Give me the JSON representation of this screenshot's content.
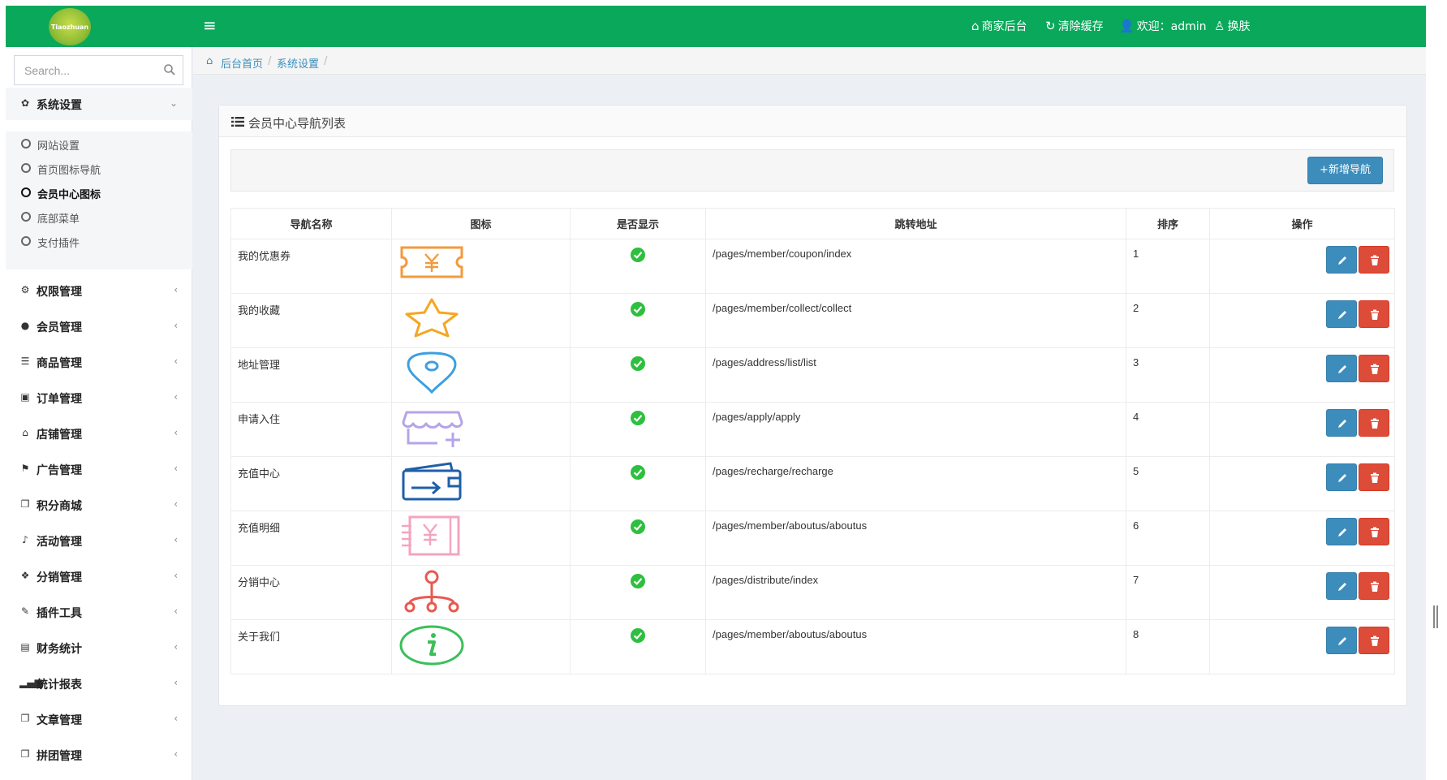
{
  "topbar": {
    "logo_text": "Tiaozhuan",
    "links": [
      {
        "label": "商家后台",
        "icon": "home-icon"
      },
      {
        "label": "清除缓存",
        "icon": "refresh-icon"
      },
      {
        "label": "欢迎：admin",
        "icon": "user-icon"
      },
      {
        "label": "换肤",
        "icon": "person-icon"
      }
    ]
  },
  "sidebar": {
    "search_placeholder": "Search...",
    "active_group": {
      "label": "系统设置",
      "icon": "gear-icon"
    },
    "sub_items": [
      {
        "label": "网站设置"
      },
      {
        "label": "首页图标导航"
      },
      {
        "label": "会员中心图标"
      },
      {
        "label": "底部菜单"
      },
      {
        "label": "支付插件"
      }
    ],
    "groups": [
      {
        "label": "权限管理",
        "icon": "cogs-icon"
      },
      {
        "label": "会员管理",
        "icon": "user-icon"
      },
      {
        "label": "商品管理",
        "icon": "list-icon"
      },
      {
        "label": "订单管理",
        "icon": "money-icon"
      },
      {
        "label": "店铺管理",
        "icon": "home-icon"
      },
      {
        "label": "广告管理",
        "icon": "flag-icon"
      },
      {
        "label": "积分商城",
        "icon": "copy-icon"
      },
      {
        "label": "活动管理",
        "icon": "bell-icon"
      },
      {
        "label": "分销管理",
        "icon": "cubes-icon"
      },
      {
        "label": "插件工具",
        "icon": "plug-icon"
      },
      {
        "label": "财务统计",
        "icon": "book-icon"
      },
      {
        "label": "统计报表",
        "icon": "signal-icon"
      },
      {
        "label": "文章管理",
        "icon": "copy-icon"
      },
      {
        "label": "拼团管理",
        "icon": "copy-icon"
      }
    ]
  },
  "breadcrumb": {
    "items": [
      "后台首页",
      "系统设置"
    ],
    "separator": "/"
  },
  "panel": {
    "title": "会员中心导航列表",
    "add_button": "+新增导航",
    "table": {
      "headers": [
        "导航名称",
        "图标",
        "是否显示",
        "跳转地址",
        "排序",
        "操作"
      ],
      "rows": [
        {
          "name": "我的优惠券",
          "icon": "coupon-icon",
          "color": "#f39a3c",
          "url": "/pages/member/coupon/index",
          "sort": "1"
        },
        {
          "name": "我的收藏",
          "icon": "star-icon",
          "color": "#f5a623",
          "url": "/pages/member/collect/collect",
          "sort": "2"
        },
        {
          "name": "地址管理",
          "icon": "location-pin-icon",
          "color": "#3d9fe0",
          "url": "/pages/address/list/list",
          "sort": "3"
        },
        {
          "name": "申请入住",
          "icon": "shop-add-icon",
          "color": "#b6a4e8",
          "url": "/pages/apply/apply",
          "sort": "4"
        },
        {
          "name": "充值中心",
          "icon": "wallet-icon",
          "color": "#1f5fa8",
          "url": "/pages/recharge/recharge",
          "sort": "5"
        },
        {
          "name": "充值明细",
          "icon": "bill-icon",
          "color": "#f3a4c0",
          "url": "/pages/member/aboutus/aboutus",
          "sort": "6"
        },
        {
          "name": "分销中心",
          "icon": "distribution-tree-icon",
          "color": "#e8594f",
          "url": "/pages/distribute/index",
          "sort": "7"
        },
        {
          "name": "关于我们",
          "icon": "info-icon",
          "color": "#3bbf5a",
          "url": "/pages/member/aboutus/aboutus",
          "sort": "8"
        }
      ]
    }
  },
  "colors": {
    "topbar": "#09a85a",
    "primary": "#3c8dbc",
    "danger": "#dd4b39",
    "success": "#2ebf3f"
  }
}
